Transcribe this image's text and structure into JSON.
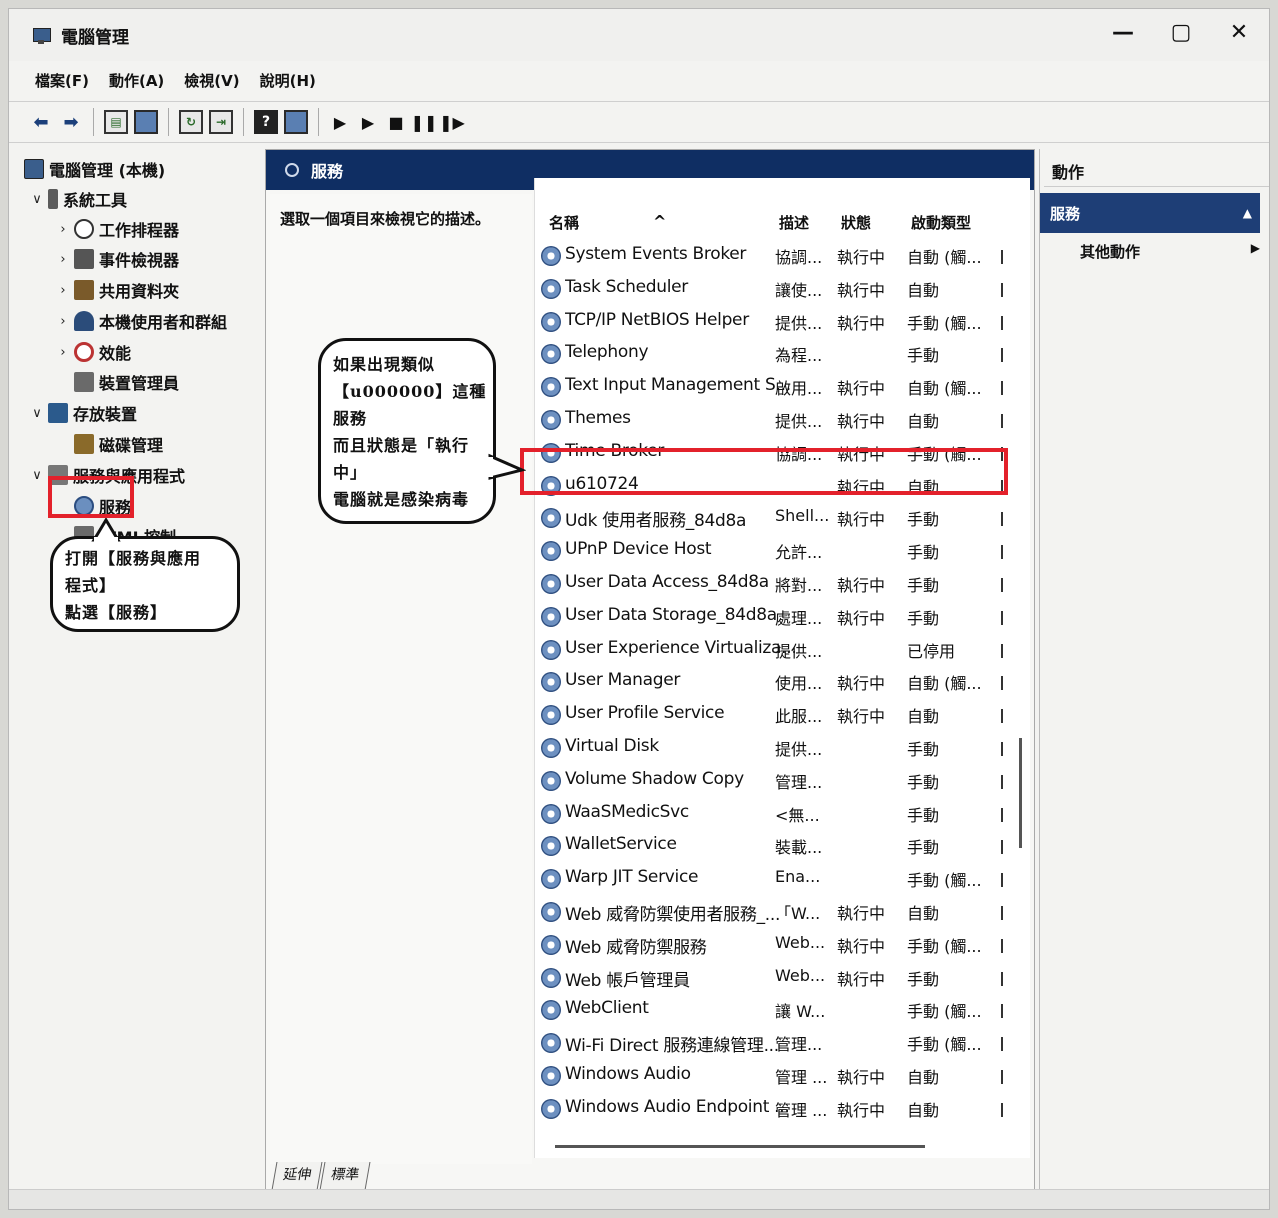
{
  "window": {
    "title": "電腦管理",
    "controls": [
      "—",
      "▢",
      "✕"
    ]
  },
  "menu": [
    "檔案(F)",
    "動作(A)",
    "檢視(V)",
    "說明(H)"
  ],
  "tree": {
    "root": "電腦管理 (本機)",
    "system_tools": "系統工具",
    "task_scheduler": "工作排程器",
    "event_viewer": "事件檢視器",
    "shared_folders": "共用資料夾",
    "local_users": "本機使用者和群組",
    "performance": "效能",
    "device_manager": "裝置管理員",
    "storage": "存放裝置",
    "disk_management": "磁碟管理",
    "services_apps": "服務與應用程式",
    "services": "服務",
    "wmi": "WMI 控制"
  },
  "center": {
    "header": "服務",
    "description_hint": "選取一個項目來檢視它的描述。",
    "columns": {
      "name": "名稱",
      "desc": "描述",
      "status": "狀態",
      "startup": "啟動類型"
    },
    "rows": [
      {
        "name": "System Events Broker",
        "desc": "協調...",
        "status": "執行中",
        "startup": "自動 (觸..."
      },
      {
        "name": "Task Scheduler",
        "desc": "讓使...",
        "status": "執行中",
        "startup": "自動"
      },
      {
        "name": "TCP/IP NetBIOS Helper",
        "desc": "提供...",
        "status": "執行中",
        "startup": "手動 (觸..."
      },
      {
        "name": "Telephony",
        "desc": "為程...",
        "status": "",
        "startup": "手動"
      },
      {
        "name": "Text Input Management S...",
        "desc": "啟用...",
        "status": "執行中",
        "startup": "自動 (觸..."
      },
      {
        "name": "Themes",
        "desc": "提供...",
        "status": "執行中",
        "startup": "自動"
      },
      {
        "name": "Time Broker",
        "desc": "協調...",
        "status": "執行中",
        "startup": "手動 (觸..."
      },
      {
        "name": "u610724",
        "desc": "",
        "status": "執行中",
        "startup": "自動"
      },
      {
        "name": "Udk 使用者服務_84d8a",
        "desc": "Shell...",
        "status": "執行中",
        "startup": "手動"
      },
      {
        "name": "UPnP Device Host",
        "desc": "允許...",
        "status": "",
        "startup": "手動"
      },
      {
        "name": "User Data Access_84d8a",
        "desc": "將對...",
        "status": "執行中",
        "startup": "手動"
      },
      {
        "name": "User Data Storage_84d8a",
        "desc": "處理...",
        "status": "執行中",
        "startup": "手動"
      },
      {
        "name": "User Experience Virtualiza...",
        "desc": "提供...",
        "status": "",
        "startup": "已停用"
      },
      {
        "name": "User Manager",
        "desc": "使用...",
        "status": "執行中",
        "startup": "自動 (觸..."
      },
      {
        "name": "User Profile Service",
        "desc": "此服...",
        "status": "執行中",
        "startup": "自動"
      },
      {
        "name": "Virtual Disk",
        "desc": "提供...",
        "status": "",
        "startup": "手動"
      },
      {
        "name": "Volume Shadow Copy",
        "desc": "管理...",
        "status": "",
        "startup": "手動"
      },
      {
        "name": "WaaSMedicSvc",
        "desc": "<無...",
        "status": "",
        "startup": "手動"
      },
      {
        "name": "WalletService",
        "desc": "裝載...",
        "status": "",
        "startup": "手動"
      },
      {
        "name": "Warp JIT Service",
        "desc": "Ena...",
        "status": "",
        "startup": "手動 (觸..."
      },
      {
        "name": "Web 威脅防禦使用者服務_...",
        "desc": "「W...",
        "status": "執行中",
        "startup": "自動"
      },
      {
        "name": "Web 威脅防禦服務",
        "desc": "Web...",
        "status": "執行中",
        "startup": "手動 (觸..."
      },
      {
        "name": "Web 帳戶管理員",
        "desc": "Web...",
        "status": "執行中",
        "startup": "手動"
      },
      {
        "name": "WebClient",
        "desc": "讓 W...",
        "status": "",
        "startup": "手動 (觸..."
      },
      {
        "name": "Wi-Fi Direct 服務連線管理...",
        "desc": "管理...",
        "status": "",
        "startup": "手動 (觸..."
      },
      {
        "name": "Windows Audio",
        "desc": "管理 ...",
        "status": "執行中",
        "startup": "自動"
      },
      {
        "name": "Windows Audio Endpoint ...",
        "desc": "管理 ...",
        "status": "執行中",
        "startup": "自動"
      }
    ],
    "tabs": [
      "延伸",
      "標準"
    ]
  },
  "actions": {
    "title": "動作",
    "selected": "服務",
    "more": "其他動作"
  },
  "annotations": {
    "bubble1": [
      "如果出現類似",
      "【u000000】這種",
      "服務",
      "而且狀態是「執行",
      "中」",
      "電腦就是感染病毒"
    ],
    "bubble2": [
      "打開【服務與應用",
      "程式】",
      "點選【服務】"
    ]
  },
  "colors": {
    "header_blue": "#0f2e63",
    "highlight_red": "#e3212b",
    "selected_blue": "#1e3e76"
  }
}
